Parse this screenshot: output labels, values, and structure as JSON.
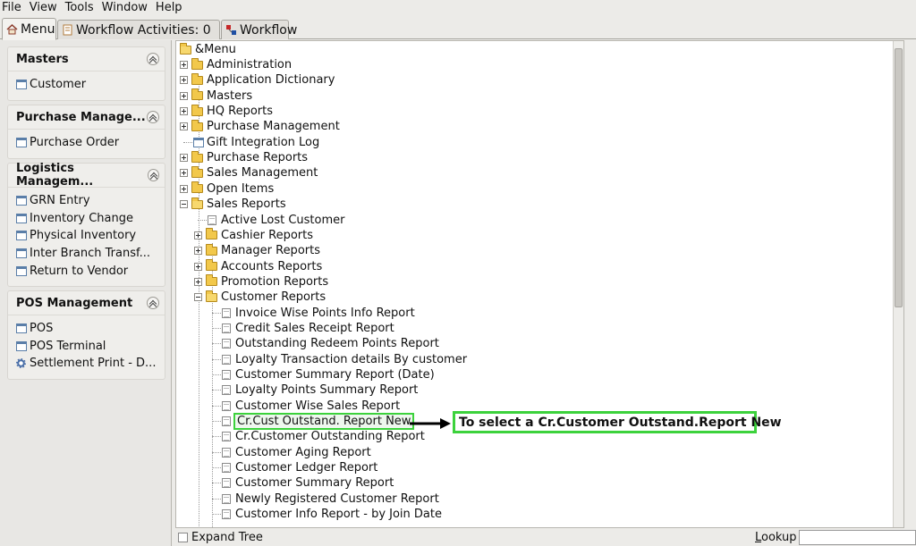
{
  "menubar": {
    "items": [
      "File",
      "View",
      "Tools",
      "Window",
      "Help"
    ]
  },
  "tabs": [
    {
      "label": "Menu",
      "icon": "home-icon",
      "active": true
    },
    {
      "label": "Workflow Activities: 0",
      "icon": "notepad-icon",
      "active": false
    },
    {
      "label": "Workflow",
      "icon": "workflow-icon",
      "active": false
    }
  ],
  "sidebar": {
    "groups": [
      {
        "title": "Masters",
        "items": [
          {
            "label": "Customer",
            "icon": "window-icon"
          }
        ]
      },
      {
        "title": "Purchase Manage...",
        "items": [
          {
            "label": "Purchase Order",
            "icon": "window-icon"
          }
        ]
      },
      {
        "title": "Logistics Managem...",
        "items": [
          {
            "label": "GRN Entry",
            "icon": "window-icon"
          },
          {
            "label": "Inventory Change",
            "icon": "window-icon"
          },
          {
            "label": "Physical Inventory",
            "icon": "window-icon"
          },
          {
            "label": "Inter Branch Transf...",
            "icon": "window-icon"
          },
          {
            "label": "Return to Vendor",
            "icon": "window-icon"
          }
        ]
      },
      {
        "title": "POS Management",
        "items": [
          {
            "label": "POS",
            "icon": "window-icon"
          },
          {
            "label": "POS Terminal",
            "icon": "window-icon"
          },
          {
            "label": "Settlement Print - D...",
            "icon": "gear-icon"
          }
        ]
      }
    ]
  },
  "tree": {
    "root": "&Menu",
    "nodes": [
      {
        "label": "Administration",
        "type": "folder",
        "level": 1,
        "expanded": false
      },
      {
        "label": "Application Dictionary",
        "type": "folder",
        "level": 1,
        "expanded": false
      },
      {
        "label": "Masters",
        "type": "folder",
        "level": 1,
        "expanded": false
      },
      {
        "label": "HQ Reports",
        "type": "folder",
        "level": 1,
        "expanded": false
      },
      {
        "label": "Purchase Management",
        "type": "folder",
        "level": 1,
        "expanded": false
      },
      {
        "label": "Gift Integration Log",
        "type": "window",
        "level": 1
      },
      {
        "label": "Purchase Reports",
        "type": "folder",
        "level": 1,
        "expanded": false
      },
      {
        "label": "Sales Management",
        "type": "folder",
        "level": 1,
        "expanded": false
      },
      {
        "label": "Open Items",
        "type": "folder",
        "level": 1,
        "expanded": false
      },
      {
        "label": "Sales Reports",
        "type": "folder",
        "level": 1,
        "expanded": true
      },
      {
        "label": "Active Lost Customer",
        "type": "report",
        "level": 2
      },
      {
        "label": "Cashier Reports",
        "type": "folder",
        "level": 2,
        "expanded": false
      },
      {
        "label": "Manager Reports",
        "type": "folder",
        "level": 2,
        "expanded": false
      },
      {
        "label": "Accounts Reports",
        "type": "folder",
        "level": 2,
        "expanded": false
      },
      {
        "label": "Promotion Reports",
        "type": "folder",
        "level": 2,
        "expanded": false
      },
      {
        "label": "Customer Reports",
        "type": "folder",
        "level": 2,
        "expanded": true
      },
      {
        "label": "Invoice Wise Points Info Report",
        "type": "report",
        "level": 3
      },
      {
        "label": "Credit Sales Receipt Report",
        "type": "report",
        "level": 3
      },
      {
        "label": "Outstanding Redeem Points Report",
        "type": "report",
        "level": 3
      },
      {
        "label": "Loyalty Transaction details By customer",
        "type": "report",
        "level": 3
      },
      {
        "label": "Customer Summary Report (Date)",
        "type": "report",
        "level": 3
      },
      {
        "label": "Loyalty Points Summary Report",
        "type": "report",
        "level": 3
      },
      {
        "label": "Customer Wise Sales Report",
        "type": "report",
        "level": 3
      },
      {
        "label": "Cr.Cust Outstand. Report New",
        "type": "report",
        "level": 3,
        "highlighted": true
      },
      {
        "label": "Cr.Customer Outstanding Report",
        "type": "report",
        "level": 3
      },
      {
        "label": "Customer Aging Report",
        "type": "report",
        "level": 3
      },
      {
        "label": "Customer Ledger Report",
        "type": "report",
        "level": 3
      },
      {
        "label": "Customer Summary Report",
        "type": "report",
        "level": 3
      },
      {
        "label": "Newly Registered Customer Report",
        "type": "report",
        "level": 3
      },
      {
        "label": "Customer Info Report - by Join Date",
        "type": "report",
        "level": 3
      }
    ]
  },
  "annotation": {
    "text": "To select a Cr.Customer Outstand.Report New",
    "color": "#3cd23c"
  },
  "statusbar": {
    "expand_tree_label": "Expand Tree",
    "lookup_label": "Lookup",
    "lookup_value": ""
  }
}
